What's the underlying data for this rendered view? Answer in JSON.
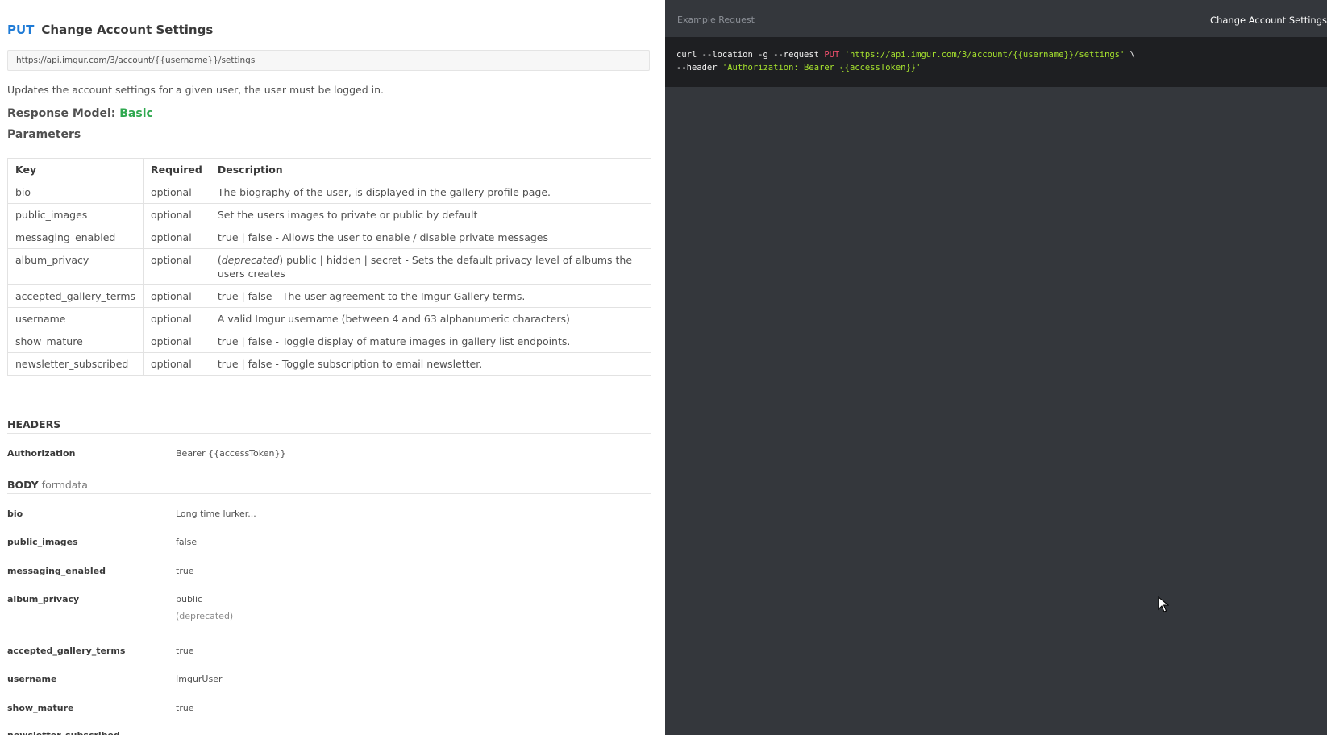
{
  "request": {
    "method": "PUT",
    "title": "Change Account Settings",
    "url": "https://api.imgur.com/3/account/{{username}}/settings",
    "description": "Updates the account settings for a given user, the user must be logged in.",
    "response_model_label": "Response Model:",
    "response_model_value": "Basic",
    "parameters_heading": "Parameters"
  },
  "params_table": {
    "headers": [
      "Key",
      "Required",
      "Description"
    ],
    "rows": [
      {
        "key": "bio",
        "required": "optional",
        "description": "The biography of the user, is displayed in the gallery profile page."
      },
      {
        "key": "public_images",
        "required": "optional",
        "description": "Set the users images to private or public by default"
      },
      {
        "key": "messaging_enabled",
        "required": "optional",
        "description": "true | false - Allows the user to enable / disable private messages"
      },
      {
        "key": "album_privacy",
        "required": "optional",
        "description_em": "deprecated",
        "description_rest": " public | hidden | secret - Sets the default privacy level of albums the users creates"
      },
      {
        "key": "accepted_gallery_terms",
        "required": "optional",
        "description": "true | false - The user agreement to the Imgur Gallery terms."
      },
      {
        "key": "username",
        "required": "optional",
        "description": "A valid Imgur username (between 4 and 63 alphanumeric characters)"
      },
      {
        "key": "show_mature",
        "required": "optional",
        "description": "true | false - Toggle display of mature images in gallery list endpoints."
      },
      {
        "key": "newsletter_subscribed",
        "required": "optional",
        "description": "true | false - Toggle subscription to email newsletter."
      }
    ]
  },
  "headers_section": {
    "label": "HEADERS",
    "items": [
      {
        "key": "Authorization",
        "value": "Bearer {{accessToken}}"
      }
    ]
  },
  "body_section": {
    "label": "BODY",
    "sublabel": "formdata",
    "items": [
      {
        "key": "bio",
        "value": "Long time lurker..."
      },
      {
        "key": "public_images",
        "value": "false"
      },
      {
        "key": "messaging_enabled",
        "value": "true"
      },
      {
        "key": "album_privacy",
        "value": "public",
        "note": "(deprecated)"
      },
      {
        "key": "accepted_gallery_terms",
        "value": "true"
      },
      {
        "key": "username",
        "value": "ImgurUser"
      },
      {
        "key": "show_mature",
        "value": "true"
      },
      {
        "key": "newsletter_subscribed",
        "value": ""
      }
    ]
  },
  "example": {
    "label": "Example Request",
    "title": "Change Account Settings",
    "line1_cmd": "curl --location -g --request ",
    "line1_method": "PUT",
    "line1_url": "'https://api.imgur.com/3/account/{{username}}/settings'",
    "line1_tail": " \\",
    "line2_cmd": "--header ",
    "line2_value": "'Authorization: Bearer {{accessToken}}'"
  },
  "colors": {
    "method_blue": "#1f7bd6",
    "response_model_green": "#2fa84f",
    "dark_pane": "#34373c",
    "code_bg": "#1e1f22",
    "code_method": "#f0506e",
    "code_string": "#a6e22e"
  },
  "icons": {
    "cursor": "mouse-pointer-icon"
  }
}
